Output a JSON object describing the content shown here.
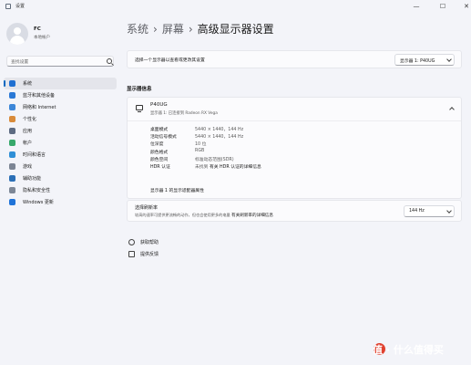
{
  "window": {
    "title": "设置",
    "controls": {
      "minimize": "—",
      "maximize": "☐",
      "close": "✕"
    }
  },
  "user": {
    "name": "FC",
    "account_type": "本地帐户"
  },
  "search": {
    "placeholder": "查找设置"
  },
  "sidebar": {
    "items": [
      {
        "label": "系统",
        "icon": "system-icon",
        "color": "#1f6fd1",
        "active": true
      },
      {
        "label": "蓝牙和其他设备",
        "icon": "bluetooth-icon",
        "color": "#2b79d6"
      },
      {
        "label": "网络和 Internet",
        "icon": "network-icon",
        "color": "#3c86d8"
      },
      {
        "label": "个性化",
        "icon": "brush-icon",
        "color": "#d98b3a"
      },
      {
        "label": "应用",
        "icon": "apps-icon",
        "color": "#5d6b82"
      },
      {
        "label": "帐户",
        "icon": "account-icon",
        "color": "#37a86b"
      },
      {
        "label": "时间和语言",
        "icon": "globe-icon",
        "color": "#2f8fd6"
      },
      {
        "label": "游戏",
        "icon": "gamepad-icon",
        "color": "#7c8594"
      },
      {
        "label": "辅助功能",
        "icon": "accessibility-icon",
        "color": "#2b6fb6"
      },
      {
        "label": "隐私和安全性",
        "icon": "shield-icon",
        "color": "#7d8796"
      },
      {
        "label": "Windows 更新",
        "icon": "update-icon",
        "color": "#1f73d8"
      }
    ]
  },
  "breadcrumb": {
    "level1": "系统",
    "level2": "屏幕",
    "current": "高级显示器设置",
    "separator": "›"
  },
  "display_select": {
    "prompt": "选择一个显示器以查看或更改其设置",
    "value": "显示器 1: P40UG"
  },
  "display_info": {
    "section_title": "显示器信息",
    "monitor_name": "P40UG",
    "monitor_sub": "显示器 1: 已连接到 Radeon RX Vega",
    "rows": [
      {
        "label": "桌面模式",
        "value": "5440 × 1440，144 Hz"
      },
      {
        "label": "活动信号模式",
        "value": "5440 × 1440，144 Hz"
      },
      {
        "label": "位深度",
        "value": "10 位"
      },
      {
        "label": "颜色格式",
        "value": "RGB"
      },
      {
        "label": "颜色空间",
        "value": "标准动态范围(SDR)"
      },
      {
        "label": "HDR 认证",
        "value": "未找到",
        "link": "有关 HDR 认证的详细信息"
      }
    ],
    "properties_link": "显示器 1 的显示适配器属性"
  },
  "refresh_rate": {
    "title": "选择刷新率",
    "description": "较高的速率可提供更流畅的动作，但也会使用更多的电量",
    "link": "有关刷新率的详细信息",
    "value": "144 Hz"
  },
  "help": {
    "get_help": "获取帮助",
    "feedback": "提供反馈"
  },
  "watermark": "值 · 什么值得买"
}
